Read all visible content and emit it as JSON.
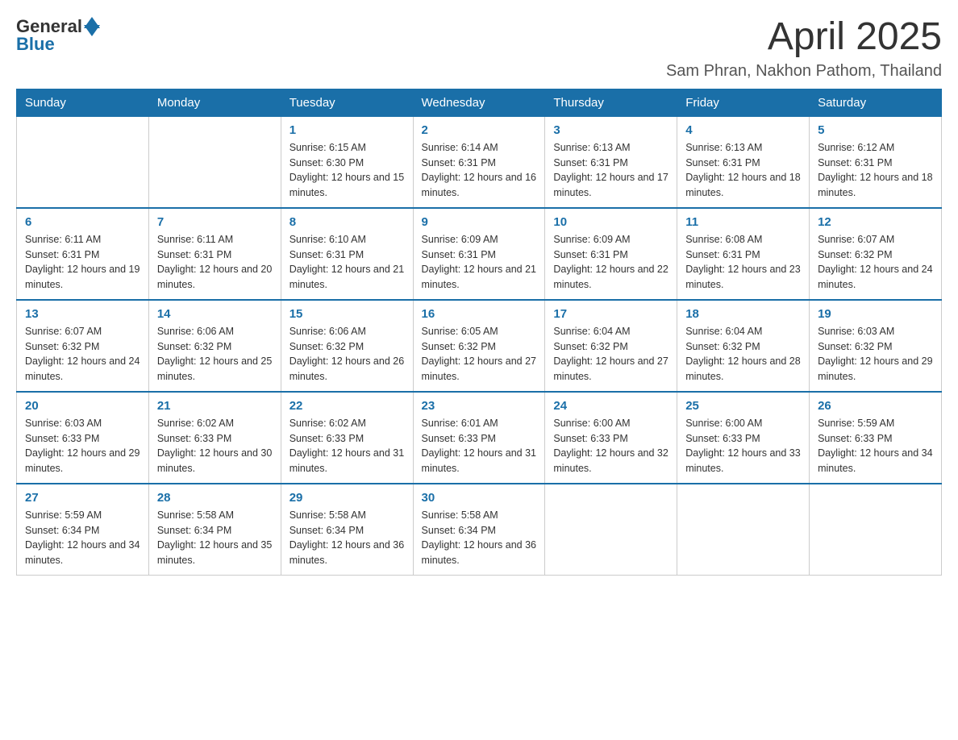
{
  "logo": {
    "text_general": "General",
    "text_blue": "Blue"
  },
  "title": "April 2025",
  "location": "Sam Phran, Nakhon Pathom, Thailand",
  "weekdays": [
    "Sunday",
    "Monday",
    "Tuesday",
    "Wednesday",
    "Thursday",
    "Friday",
    "Saturday"
  ],
  "weeks": [
    [
      {
        "day": "",
        "info": ""
      },
      {
        "day": "",
        "info": ""
      },
      {
        "day": "1",
        "info": "Sunrise: 6:15 AM\nSunset: 6:30 PM\nDaylight: 12 hours and 15 minutes."
      },
      {
        "day": "2",
        "info": "Sunrise: 6:14 AM\nSunset: 6:31 PM\nDaylight: 12 hours and 16 minutes."
      },
      {
        "day": "3",
        "info": "Sunrise: 6:13 AM\nSunset: 6:31 PM\nDaylight: 12 hours and 17 minutes."
      },
      {
        "day": "4",
        "info": "Sunrise: 6:13 AM\nSunset: 6:31 PM\nDaylight: 12 hours and 18 minutes."
      },
      {
        "day": "5",
        "info": "Sunrise: 6:12 AM\nSunset: 6:31 PM\nDaylight: 12 hours and 18 minutes."
      }
    ],
    [
      {
        "day": "6",
        "info": "Sunrise: 6:11 AM\nSunset: 6:31 PM\nDaylight: 12 hours and 19 minutes."
      },
      {
        "day": "7",
        "info": "Sunrise: 6:11 AM\nSunset: 6:31 PM\nDaylight: 12 hours and 20 minutes."
      },
      {
        "day": "8",
        "info": "Sunrise: 6:10 AM\nSunset: 6:31 PM\nDaylight: 12 hours and 21 minutes."
      },
      {
        "day": "9",
        "info": "Sunrise: 6:09 AM\nSunset: 6:31 PM\nDaylight: 12 hours and 21 minutes."
      },
      {
        "day": "10",
        "info": "Sunrise: 6:09 AM\nSunset: 6:31 PM\nDaylight: 12 hours and 22 minutes."
      },
      {
        "day": "11",
        "info": "Sunrise: 6:08 AM\nSunset: 6:31 PM\nDaylight: 12 hours and 23 minutes."
      },
      {
        "day": "12",
        "info": "Sunrise: 6:07 AM\nSunset: 6:32 PM\nDaylight: 12 hours and 24 minutes."
      }
    ],
    [
      {
        "day": "13",
        "info": "Sunrise: 6:07 AM\nSunset: 6:32 PM\nDaylight: 12 hours and 24 minutes."
      },
      {
        "day": "14",
        "info": "Sunrise: 6:06 AM\nSunset: 6:32 PM\nDaylight: 12 hours and 25 minutes."
      },
      {
        "day": "15",
        "info": "Sunrise: 6:06 AM\nSunset: 6:32 PM\nDaylight: 12 hours and 26 minutes."
      },
      {
        "day": "16",
        "info": "Sunrise: 6:05 AM\nSunset: 6:32 PM\nDaylight: 12 hours and 27 minutes."
      },
      {
        "day": "17",
        "info": "Sunrise: 6:04 AM\nSunset: 6:32 PM\nDaylight: 12 hours and 27 minutes."
      },
      {
        "day": "18",
        "info": "Sunrise: 6:04 AM\nSunset: 6:32 PM\nDaylight: 12 hours and 28 minutes."
      },
      {
        "day": "19",
        "info": "Sunrise: 6:03 AM\nSunset: 6:32 PM\nDaylight: 12 hours and 29 minutes."
      }
    ],
    [
      {
        "day": "20",
        "info": "Sunrise: 6:03 AM\nSunset: 6:33 PM\nDaylight: 12 hours and 29 minutes."
      },
      {
        "day": "21",
        "info": "Sunrise: 6:02 AM\nSunset: 6:33 PM\nDaylight: 12 hours and 30 minutes."
      },
      {
        "day": "22",
        "info": "Sunrise: 6:02 AM\nSunset: 6:33 PM\nDaylight: 12 hours and 31 minutes."
      },
      {
        "day": "23",
        "info": "Sunrise: 6:01 AM\nSunset: 6:33 PM\nDaylight: 12 hours and 31 minutes."
      },
      {
        "day": "24",
        "info": "Sunrise: 6:00 AM\nSunset: 6:33 PM\nDaylight: 12 hours and 32 minutes."
      },
      {
        "day": "25",
        "info": "Sunrise: 6:00 AM\nSunset: 6:33 PM\nDaylight: 12 hours and 33 minutes."
      },
      {
        "day": "26",
        "info": "Sunrise: 5:59 AM\nSunset: 6:33 PM\nDaylight: 12 hours and 34 minutes."
      }
    ],
    [
      {
        "day": "27",
        "info": "Sunrise: 5:59 AM\nSunset: 6:34 PM\nDaylight: 12 hours and 34 minutes."
      },
      {
        "day": "28",
        "info": "Sunrise: 5:58 AM\nSunset: 6:34 PM\nDaylight: 12 hours and 35 minutes."
      },
      {
        "day": "29",
        "info": "Sunrise: 5:58 AM\nSunset: 6:34 PM\nDaylight: 12 hours and 36 minutes."
      },
      {
        "day": "30",
        "info": "Sunrise: 5:58 AM\nSunset: 6:34 PM\nDaylight: 12 hours and 36 minutes."
      },
      {
        "day": "",
        "info": ""
      },
      {
        "day": "",
        "info": ""
      },
      {
        "day": "",
        "info": ""
      }
    ]
  ]
}
